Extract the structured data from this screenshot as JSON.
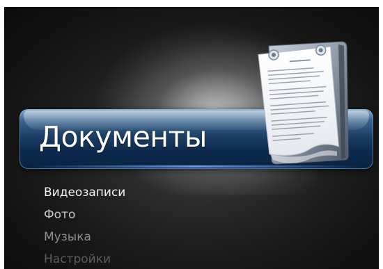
{
  "selected": {
    "label": "Документы",
    "icon": "document-icon"
  },
  "menu": {
    "items": [
      {
        "label": "Видеозаписи"
      },
      {
        "label": "Фото"
      },
      {
        "label": "Музыка"
      },
      {
        "label": "Настройки"
      }
    ]
  },
  "colors": {
    "background": "#1a1a1a",
    "selected_bar": "#1d3f66",
    "accent": "#8fb1d2"
  }
}
